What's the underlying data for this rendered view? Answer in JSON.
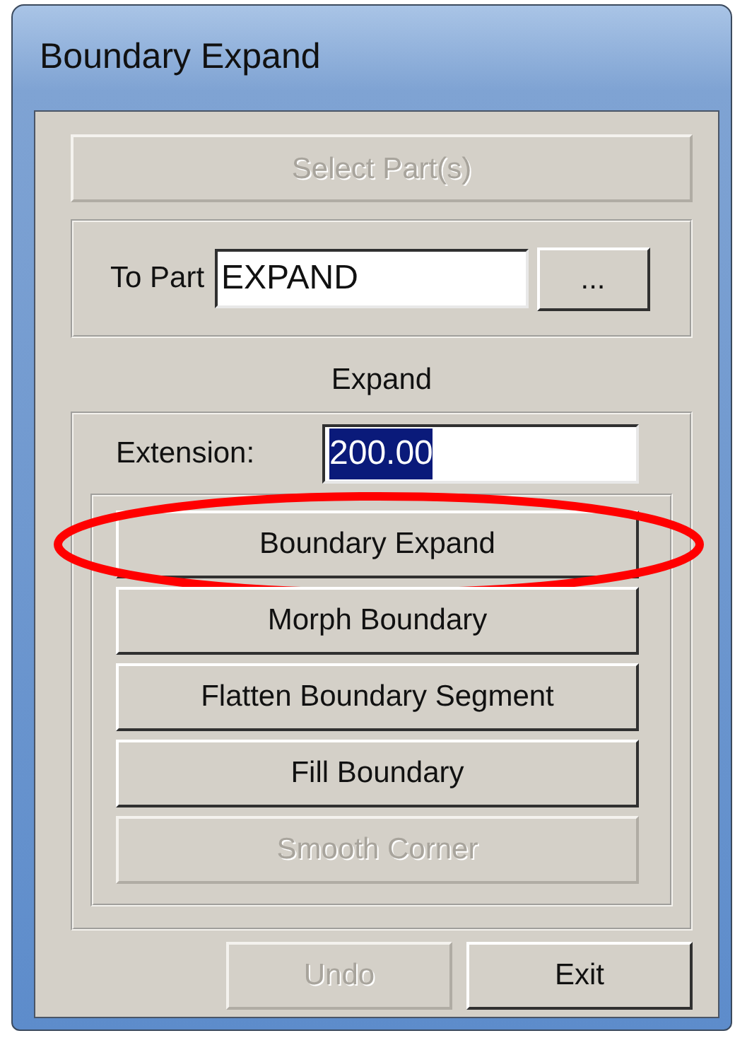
{
  "window": {
    "title": "Boundary Expand"
  },
  "select_button": {
    "label": "Select Part(s)",
    "disabled": true
  },
  "to_part": {
    "label": "To Part",
    "value": "EXPAND",
    "browse_label": "..."
  },
  "expand": {
    "heading": "Expand",
    "extension_label": "Extension:",
    "extension_value": "200.00",
    "value_selected": true
  },
  "actions": [
    {
      "label": "Boundary Expand",
      "disabled": false,
      "circled": true
    },
    {
      "label": "Morph Boundary",
      "disabled": false,
      "circled": false
    },
    {
      "label": "Flatten Boundary Segment",
      "disabled": false,
      "circled": false
    },
    {
      "label": "Fill Boundary",
      "disabled": false,
      "circled": false
    },
    {
      "label": "Smooth Corner",
      "disabled": true,
      "circled": false
    }
  ],
  "footer_buttons": [
    {
      "label": "Undo",
      "disabled": true
    },
    {
      "label": "Exit",
      "disabled": false
    }
  ]
}
